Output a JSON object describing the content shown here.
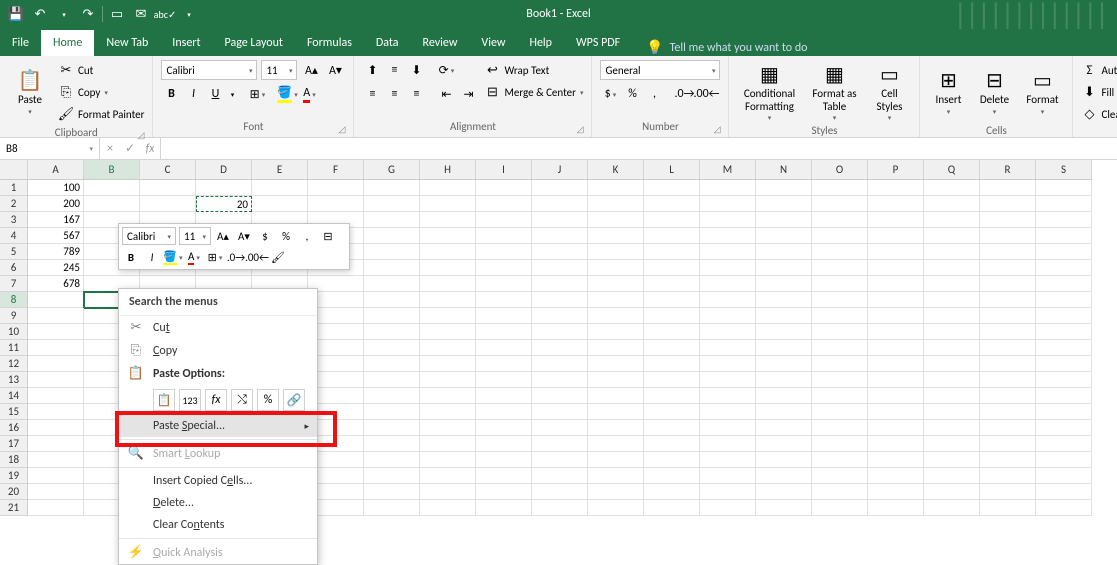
{
  "title": "Book1 - Excel",
  "qat": {
    "save": "💾",
    "undo": "↶",
    "redo": "↷"
  },
  "tabs": [
    "File",
    "Home",
    "New Tab",
    "Insert",
    "Page Layout",
    "Formulas",
    "Data",
    "Review",
    "View",
    "Help",
    "WPS PDF"
  ],
  "active_tab": "Home",
  "tell_me": "Tell me what you want to do",
  "ribbon": {
    "clipboard": {
      "paste": "Paste",
      "cut": "Cut",
      "copy": "Copy",
      "format_painter": "Format Painter",
      "label": "Clipboard"
    },
    "font": {
      "name": "Calibri",
      "size": "11",
      "label": "Font"
    },
    "alignment": {
      "wrap": "Wrap Text",
      "merge": "Merge & Center",
      "label": "Alignment"
    },
    "number": {
      "format": "General",
      "label": "Number"
    },
    "styles": {
      "cond": "Conditional Formatting",
      "table": "Format as Table",
      "cell": "Cell Styles",
      "label": "Styles"
    },
    "cells": {
      "insert": "Insert",
      "delete": "Delete",
      "format": "Format",
      "label": "Cells"
    },
    "editing": {
      "autosum": "AutoSum",
      "fill": "Fill",
      "clear": "Clear"
    }
  },
  "namebox": "B8",
  "columns": [
    "A",
    "B",
    "C",
    "D",
    "E",
    "F",
    "G",
    "H",
    "I",
    "J",
    "K",
    "L",
    "M",
    "N",
    "O",
    "P",
    "Q",
    "R",
    "S"
  ],
  "row_count": 21,
  "data": {
    "A": [
      "100",
      "200",
      "167",
      "567",
      "789",
      "245",
      "678"
    ],
    "D2": "20"
  },
  "selected_cell": "B8",
  "copied_cell": "D2",
  "mini_toolbar": {
    "font": "Calibri",
    "size": "11"
  },
  "context_menu": {
    "search": "Search the menus",
    "items": [
      {
        "icon": "✂",
        "label": "Cut",
        "accel": "t"
      },
      {
        "icon": "⎘",
        "label": "Copy",
        "accel": "C"
      },
      {
        "icon": "📋",
        "label": "Paste Options:",
        "accel": null,
        "paste_opts": true
      },
      {
        "label": "Paste Special...",
        "accel": "S",
        "submenu": true,
        "highlight": true
      },
      {
        "icon": "🔍",
        "label": "Smart Lookup",
        "accel": "L",
        "disabled": true
      },
      {
        "label": "Insert Copied Cells...",
        "accel": "E"
      },
      {
        "label": "Delete...",
        "accel": "D"
      },
      {
        "label": "Clear Contents",
        "accel": "N"
      },
      {
        "icon": "⚡",
        "label": "Quick Analysis",
        "accel": "Q",
        "disabled": true
      }
    ]
  }
}
